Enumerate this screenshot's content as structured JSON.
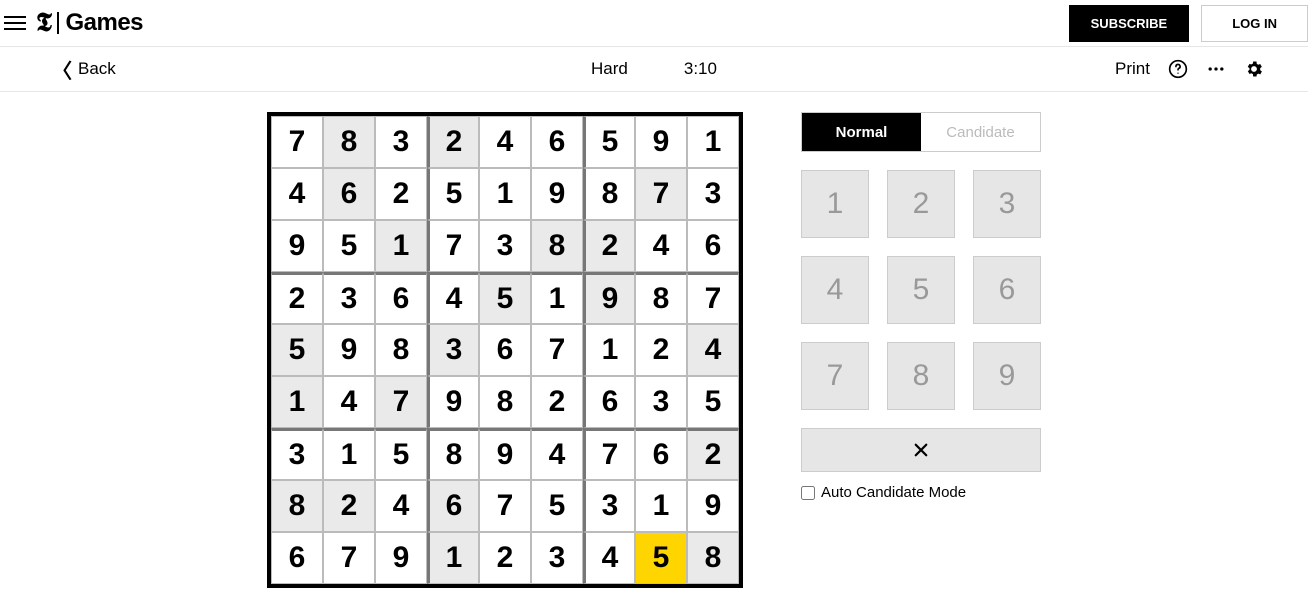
{
  "brand": {
    "t": "𝕿",
    "games": "Games"
  },
  "header": {
    "subscribe": "SUBSCRIBE",
    "login": "LOG IN"
  },
  "gamebar": {
    "back": "Back",
    "difficulty": "Hard",
    "timer": "3:10",
    "print": "Print"
  },
  "mode": {
    "normal": "Normal",
    "candidate": "Candidate",
    "active": "normal"
  },
  "numpad": [
    "1",
    "2",
    "3",
    "4",
    "5",
    "6",
    "7",
    "8",
    "9"
  ],
  "auto_label": "Auto Candidate Mode",
  "selected": {
    "row": 8,
    "col": 7
  },
  "board": [
    [
      {
        "v": "7",
        "p": false
      },
      {
        "v": "8",
        "p": true
      },
      {
        "v": "3",
        "p": false
      },
      {
        "v": "2",
        "p": true
      },
      {
        "v": "4",
        "p": false
      },
      {
        "v": "6",
        "p": false
      },
      {
        "v": "5",
        "p": false
      },
      {
        "v": "9",
        "p": false
      },
      {
        "v": "1",
        "p": false
      }
    ],
    [
      {
        "v": "4",
        "p": false
      },
      {
        "v": "6",
        "p": true
      },
      {
        "v": "2",
        "p": false
      },
      {
        "v": "5",
        "p": false
      },
      {
        "v": "1",
        "p": false
      },
      {
        "v": "9",
        "p": false
      },
      {
        "v": "8",
        "p": false
      },
      {
        "v": "7",
        "p": true
      },
      {
        "v": "3",
        "p": false
      }
    ],
    [
      {
        "v": "9",
        "p": false
      },
      {
        "v": "5",
        "p": false
      },
      {
        "v": "1",
        "p": true
      },
      {
        "v": "7",
        "p": false
      },
      {
        "v": "3",
        "p": false
      },
      {
        "v": "8",
        "p": true
      },
      {
        "v": "2",
        "p": true
      },
      {
        "v": "4",
        "p": false
      },
      {
        "v": "6",
        "p": false
      }
    ],
    [
      {
        "v": "2",
        "p": false
      },
      {
        "v": "3",
        "p": false
      },
      {
        "v": "6",
        "p": false
      },
      {
        "v": "4",
        "p": false
      },
      {
        "v": "5",
        "p": true
      },
      {
        "v": "1",
        "p": false
      },
      {
        "v": "9",
        "p": true
      },
      {
        "v": "8",
        "p": false
      },
      {
        "v": "7",
        "p": false
      }
    ],
    [
      {
        "v": "5",
        "p": true
      },
      {
        "v": "9",
        "p": false
      },
      {
        "v": "8",
        "p": false
      },
      {
        "v": "3",
        "p": true
      },
      {
        "v": "6",
        "p": false
      },
      {
        "v": "7",
        "p": false
      },
      {
        "v": "1",
        "p": false
      },
      {
        "v": "2",
        "p": false
      },
      {
        "v": "4",
        "p": true
      }
    ],
    [
      {
        "v": "1",
        "p": true
      },
      {
        "v": "4",
        "p": false
      },
      {
        "v": "7",
        "p": true
      },
      {
        "v": "9",
        "p": false
      },
      {
        "v": "8",
        "p": false
      },
      {
        "v": "2",
        "p": false
      },
      {
        "v": "6",
        "p": false
      },
      {
        "v": "3",
        "p": false
      },
      {
        "v": "5",
        "p": false
      }
    ],
    [
      {
        "v": "3",
        "p": false
      },
      {
        "v": "1",
        "p": false
      },
      {
        "v": "5",
        "p": false
      },
      {
        "v": "8",
        "p": false
      },
      {
        "v": "9",
        "p": false
      },
      {
        "v": "4",
        "p": false
      },
      {
        "v": "7",
        "p": false
      },
      {
        "v": "6",
        "p": false
      },
      {
        "v": "2",
        "p": true
      }
    ],
    [
      {
        "v": "8",
        "p": true
      },
      {
        "v": "2",
        "p": true
      },
      {
        "v": "4",
        "p": false
      },
      {
        "v": "6",
        "p": true
      },
      {
        "v": "7",
        "p": false
      },
      {
        "v": "5",
        "p": false
      },
      {
        "v": "3",
        "p": false
      },
      {
        "v": "1",
        "p": false
      },
      {
        "v": "9",
        "p": false
      }
    ],
    [
      {
        "v": "6",
        "p": false
      },
      {
        "v": "7",
        "p": false
      },
      {
        "v": "9",
        "p": false
      },
      {
        "v": "1",
        "p": true
      },
      {
        "v": "2",
        "p": false
      },
      {
        "v": "3",
        "p": false
      },
      {
        "v": "4",
        "p": false
      },
      {
        "v": "5",
        "p": false
      },
      {
        "v": "8",
        "p": true
      }
    ]
  ]
}
